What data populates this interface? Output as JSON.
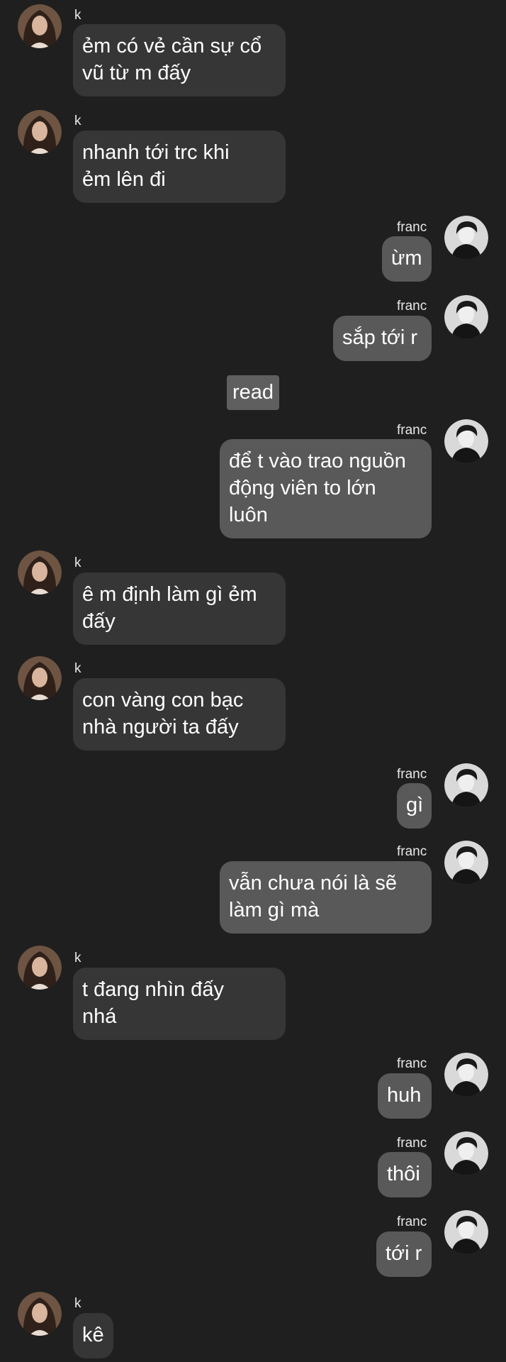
{
  "chat": {
    "users": {
      "k": {
        "name": "k"
      },
      "franc": {
        "name": "franc"
      }
    },
    "read_marker": "read",
    "messages": [
      {
        "sender": "k",
        "lines": [
          "ẻm có vẻ cần sự cổ",
          "vũ từ m đấy"
        ]
      },
      {
        "sender": "k",
        "lines": [
          "nhanh tới trc khi",
          "ẻm lên đi"
        ]
      },
      {
        "sender": "franc",
        "lines": [
          "ừm"
        ]
      },
      {
        "sender": "franc",
        "lines": [
          "sắp tới r"
        ]
      },
      {
        "sender": "franc",
        "lines": [
          "để t vào trao nguồn",
          "động viên to lớn",
          "luôn"
        ]
      },
      {
        "sender": "k",
        "lines": [
          "ê m định làm gì ẻm",
          "đấy"
        ]
      },
      {
        "sender": "k",
        "lines": [
          "con vàng con bạc",
          "nhà người ta đấy"
        ]
      },
      {
        "sender": "franc",
        "lines": [
          "gì"
        ]
      },
      {
        "sender": "franc",
        "lines": [
          "vẫn chưa nói là sẽ",
          "làm gì mà"
        ]
      },
      {
        "sender": "k",
        "lines": [
          "t đang nhìn đấy",
          "nhá"
        ]
      },
      {
        "sender": "franc",
        "lines": [
          "huh"
        ]
      },
      {
        "sender": "franc",
        "lines": [
          "thôi"
        ]
      },
      {
        "sender": "franc",
        "lines": [
          "tới r"
        ]
      },
      {
        "sender": "k",
        "lines": [
          "kê"
        ]
      }
    ]
  },
  "theme": {
    "background": "#1f1f1f",
    "incoming_bubble": "#363636",
    "outgoing_bubble": "#595959",
    "text": "#ffffff"
  }
}
